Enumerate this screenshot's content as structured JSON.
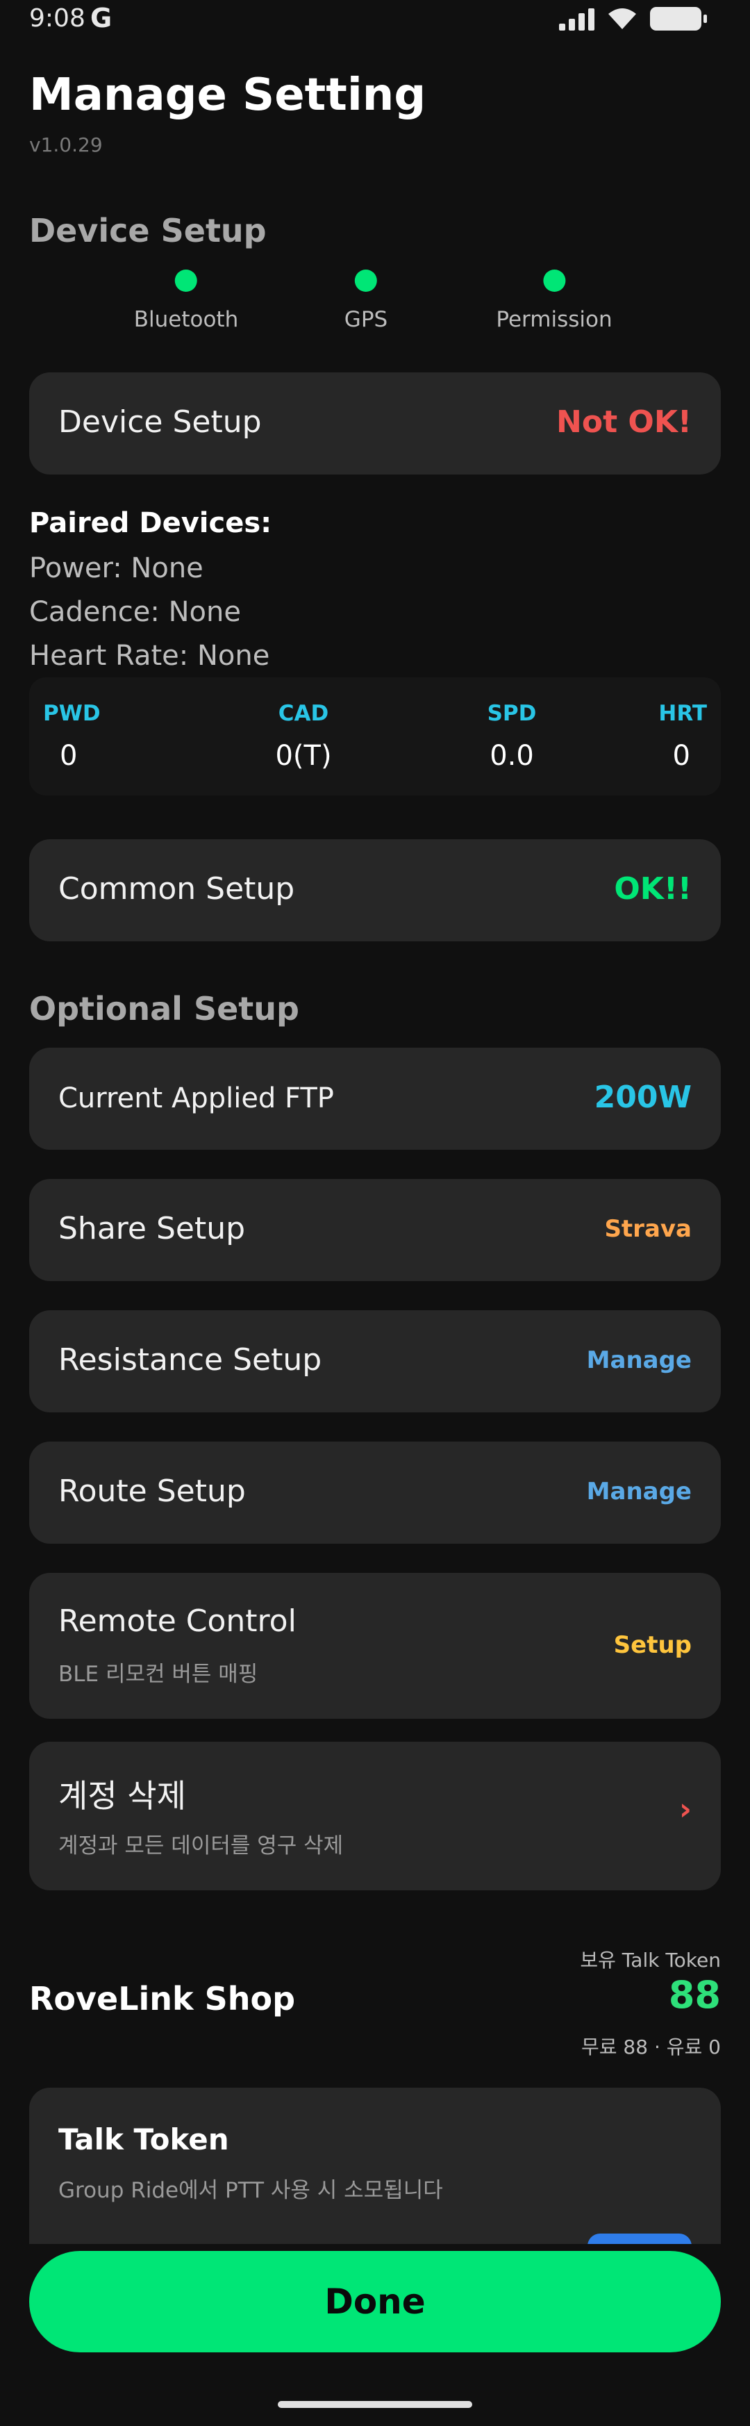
{
  "status_bar": {
    "time": "9:08",
    "g_glyph": "G",
    "icons": [
      "signal-icon",
      "wifi-icon",
      "battery-icon"
    ]
  },
  "header": {
    "title": "Manage Setting",
    "version": "v1.0.29"
  },
  "device_setup": {
    "section_title": "Device Setup",
    "indicators": [
      {
        "label": "Bluetooth",
        "status": "on"
      },
      {
        "label": "GPS",
        "status": "on"
      },
      {
        "label": "Permission",
        "status": "on"
      }
    ],
    "card_label": "Device Setup",
    "card_status": "Not OK!"
  },
  "paired": {
    "title": "Paired Devices:",
    "lines": [
      "Power: None",
      "Cadence: None",
      "Heart Rate: None"
    ]
  },
  "metrics": [
    {
      "label": "PWD",
      "value": "0"
    },
    {
      "label": "CAD",
      "value": "0(T)"
    },
    {
      "label": "SPD",
      "value": "0.0"
    },
    {
      "label": "HRT",
      "value": "0"
    }
  ],
  "common_setup": {
    "label": "Common Setup",
    "status": "OK!!"
  },
  "optional_setup": {
    "section_title": "Optional Setup",
    "ftp": {
      "label": "Current Applied FTP",
      "value": "200W"
    },
    "share": {
      "label": "Share Setup",
      "value": "Strava"
    },
    "resistance": {
      "label": "Resistance Setup",
      "value": "Manage"
    },
    "route": {
      "label": "Route Setup",
      "value": "Manage"
    },
    "remote": {
      "label": "Remote Control",
      "sub": "BLE 리모컨 버튼 매핑",
      "value": "Setup"
    },
    "delete_account": {
      "label": "계정 삭제",
      "sub": "계정과 모든 데이터를 영구 삭제",
      "chevron": "›"
    }
  },
  "shop": {
    "title": "RoveLink Shop",
    "token_caption": "보유 Talk Token",
    "token_count": "88",
    "token_detail": "무료 88 · 유료 0",
    "talk_card": {
      "title": "Talk Token",
      "desc": "Group Ride에서 PTT 사용 시 소모됩니다"
    }
  },
  "done_label": "Done",
  "colors": {
    "background": "#101010",
    "card": "#272727",
    "ok_green": "#00e676",
    "error_red": "#ef5350",
    "cyan": "#29c5e6",
    "orange": "#ffa64d",
    "blue": "#5aa9e6",
    "yellow": "#ffc53d"
  }
}
